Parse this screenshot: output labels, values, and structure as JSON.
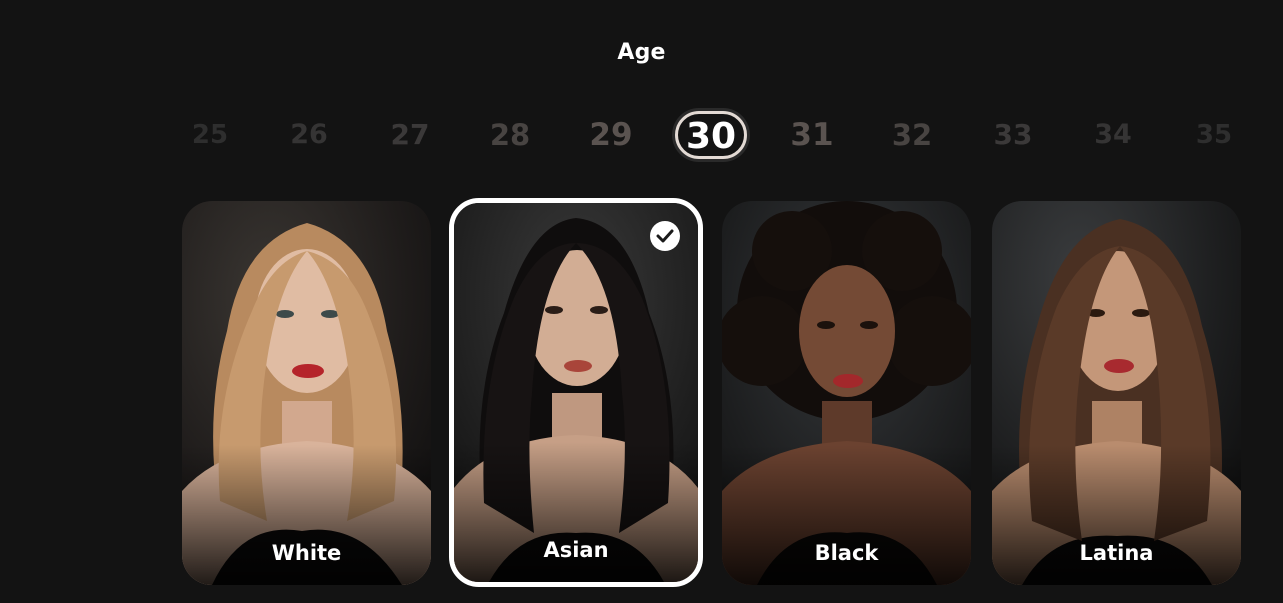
{
  "age": {
    "title": "Age",
    "values": [
      "25",
      "26",
      "27",
      "28",
      "29",
      "30",
      "31",
      "32",
      "33",
      "34",
      "35"
    ],
    "selected": "30"
  },
  "ethnicities": [
    {
      "label": "White",
      "selected": false,
      "hair": "#b88a5f",
      "skin": "#d9b39b"
    },
    {
      "label": "Asian",
      "selected": true,
      "hair": "#0f0d0d",
      "skin": "#caa38a"
    },
    {
      "label": "Black",
      "selected": false,
      "hair": "#120d0b",
      "skin": "#6b4230"
    },
    {
      "label": "Latina",
      "selected": false,
      "hair": "#4a3022",
      "skin": "#b98c6e"
    }
  ],
  "colors": {
    "background": "#131313",
    "selected_border": "#ffffff",
    "selected_age_border": "#e3dad4"
  }
}
